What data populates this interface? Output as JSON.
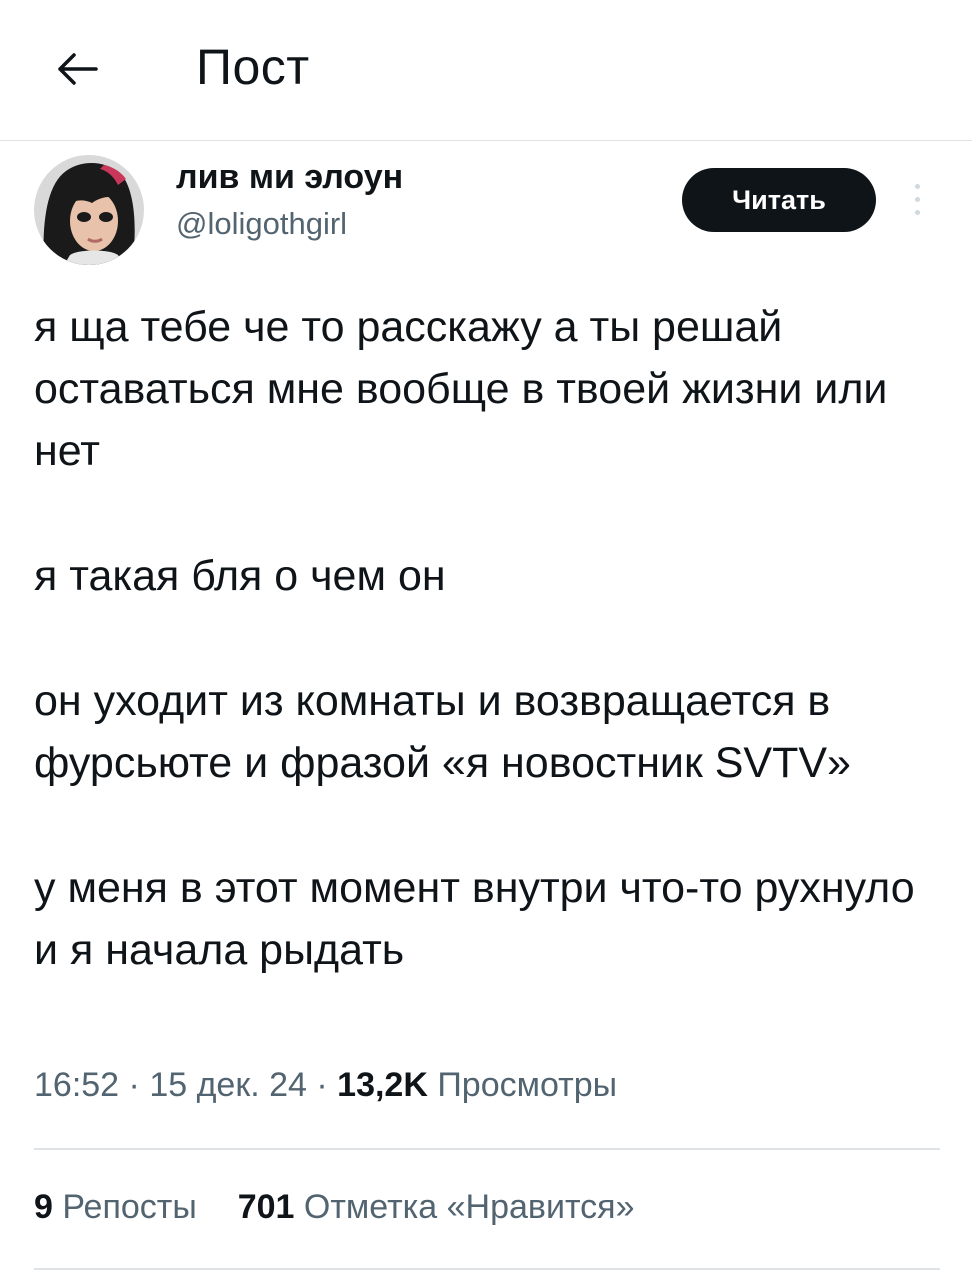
{
  "header": {
    "title": "Пост",
    "back_icon": "arrow-left-icon"
  },
  "author": {
    "display_name": "лив ми элоун",
    "handle": "@loligothgirl",
    "follow_label": "Читать",
    "more_icon": "more-vertical-icon"
  },
  "tweet": {
    "paragraphs": [
      "я ща тебе че то расскажу а ты решай оставаться мне вообще в твоей жизни или нет",
      "я такая бля о чем он",
      "он уходит из комнаты и возвращается в фурсьюте и фразой «я новостник SVTV»",
      "у меня в этот момент внутри что-то рухнуло и я начала рыдать"
    ]
  },
  "meta": {
    "time": "16:52",
    "date": "15 дек. 24",
    "views_count": "13,2K",
    "views_label": "Просмотры",
    "separator": "·"
  },
  "stats": {
    "reposts_count": "9",
    "reposts_label": "Репосты",
    "likes_count": "701",
    "likes_label": "Отметка «Нравится»"
  },
  "colors": {
    "text": "#0f1419",
    "secondary": "#536471",
    "divider": "#dfe3e6",
    "button_bg": "#0f1419",
    "button_text": "#ffffff"
  }
}
